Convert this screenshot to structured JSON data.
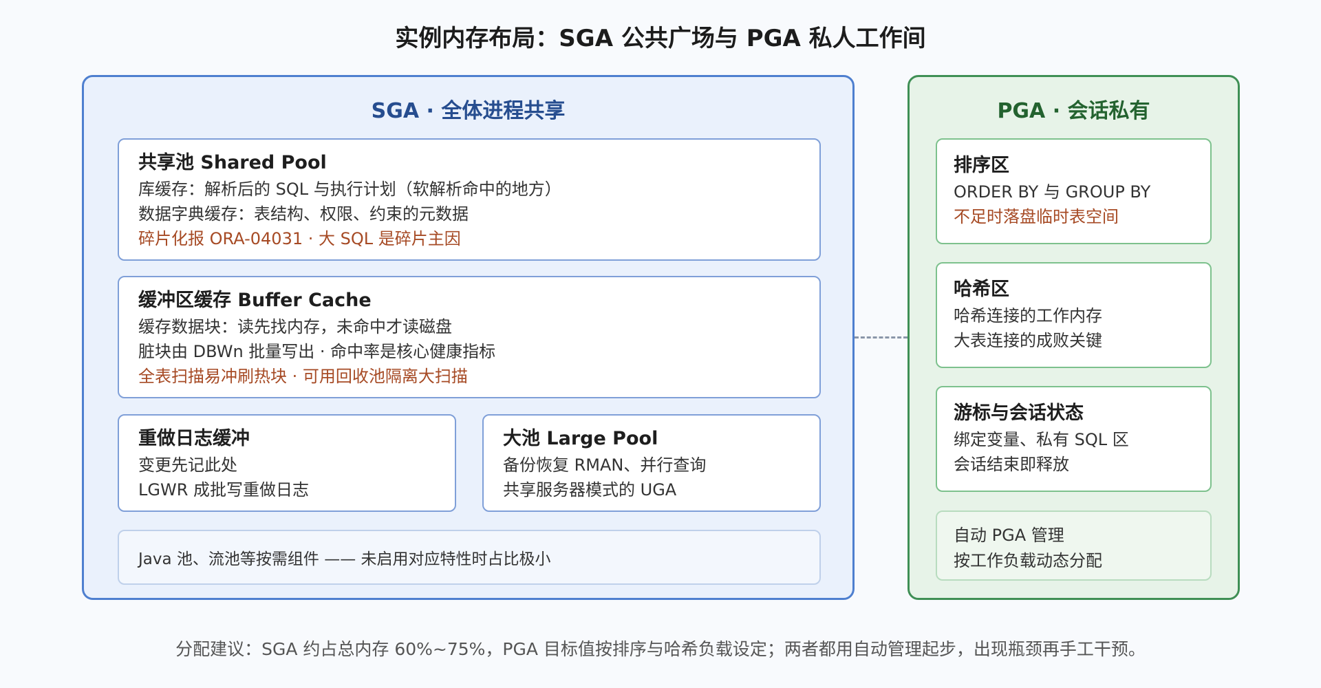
{
  "title": "实例内存布局：SGA 公共广场与 PGA 私人工作间",
  "sga": {
    "title": "SGA · 全体进程共享",
    "shared_pool": {
      "heading": "共享池 Shared Pool",
      "lines": [
        "库缓存：解析后的 SQL 与执行计划（软解析命中的地方）",
        "数据字典缓存：表结构、权限、约束的元数据"
      ],
      "warning": "碎片化报 ORA-04031 · 大 SQL 是碎片主因"
    },
    "buffer_cache": {
      "heading": "缓冲区缓存 Buffer Cache",
      "lines": [
        "缓存数据块：读先找内存，未命中才读磁盘",
        "脏块由 DBWn 批量写出 · 命中率是核心健康指标"
      ],
      "warning": "全表扫描易冲刷热块 · 可用回收池隔离大扫描"
    },
    "redo_buffer": {
      "heading": "重做日志缓冲",
      "lines": [
        "变更先记此处",
        "LGWR 成批写重做日志"
      ]
    },
    "large_pool": {
      "heading": "大池 Large Pool",
      "lines": [
        "备份恢复 RMAN、并行查询",
        "共享服务器模式的 UGA"
      ]
    },
    "other_note": "Java 池、流池等按需组件 —— 未启用对应特性时占比极小"
  },
  "pga": {
    "title": "PGA · 会话私有",
    "sort_area": {
      "heading": "排序区",
      "line": "ORDER BY 与 GROUP BY",
      "warning": "不足时落盘临时表空间"
    },
    "hash_area": {
      "heading": "哈希区",
      "lines": [
        "哈希连接的工作内存",
        "大表连接的成败关键"
      ]
    },
    "cursor_state": {
      "heading": "游标与会话状态",
      "lines": [
        "绑定变量、私有 SQL 区",
        "会话结束即释放"
      ]
    },
    "auto_pga": {
      "lines": [
        "自动 PGA 管理",
        "按工作负载动态分配"
      ]
    }
  },
  "footer": "分配建议：SGA 约占总内存 60%~75%，PGA 目标值按排序与哈希负载设定；两者都用自动管理起步，出现瓶颈再手工干预。",
  "colors": {
    "sga_border": "#4e7fcf",
    "pga_border": "#3f8f55",
    "warning_text": "#a64a24"
  }
}
